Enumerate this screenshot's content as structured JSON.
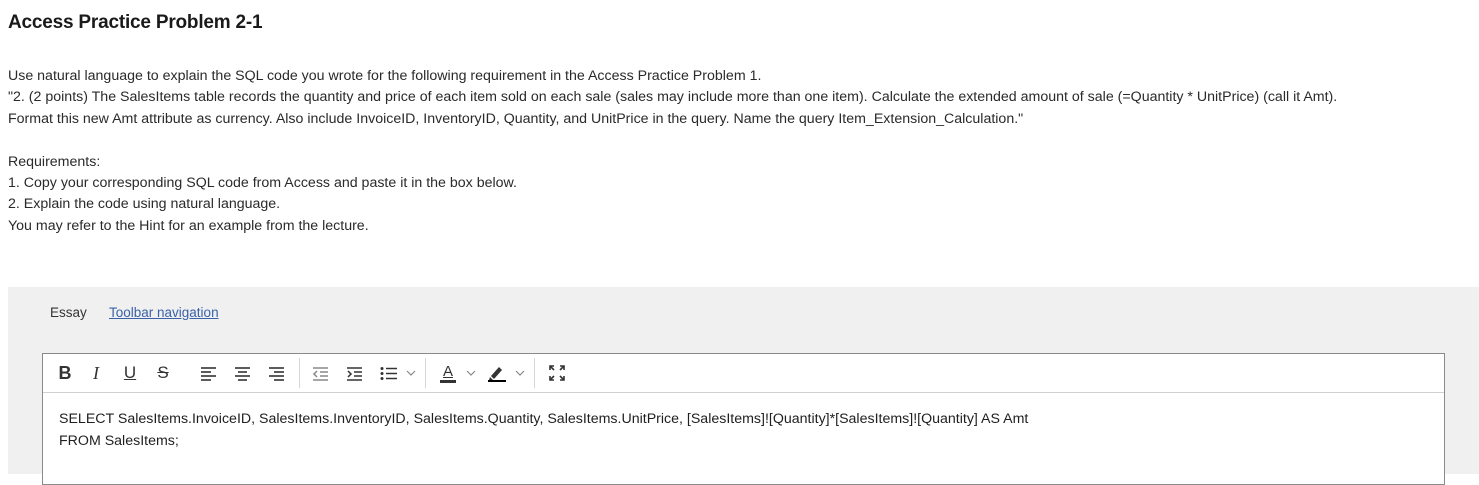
{
  "page": {
    "title": "Access Practice Problem 2-1"
  },
  "instructions": {
    "line1": "Use natural language to explain the SQL code you wrote for the following requirement in the Access Practice Problem 1.",
    "line2": "\"2. (2 points) The SalesItems table records the quantity and price of each item sold on each sale (sales may include more than one item). Calculate the extended amount of sale (=Quantity * UnitPrice) (call it Amt).",
    "line3": "Format this new Amt attribute as currency. Also include InvoiceID, InventoryID, Quantity, and UnitPrice in the query. Name the query Item_Extension_Calculation.\"",
    "requirements_heading": "Requirements:",
    "req1": "1. Copy your corresponding SQL code from Access and paste it in the box below.",
    "req2": "2. Explain the code using natural language.",
    "req3": "You may refer to the Hint for an example from the lecture."
  },
  "essay": {
    "label": "Essay",
    "toolbar_nav_link": "Toolbar navigation",
    "toolbar": {
      "bold": "B",
      "italic": "I",
      "underline": "U",
      "strike": "S",
      "font_color_letter": "A"
    },
    "content": {
      "line1": "SELECT SalesItems.InvoiceID, SalesItems.InventoryID, SalesItems.Quantity, SalesItems.UnitPrice, [SalesItems]![Quantity]*[SalesItems]![Quantity] AS Amt",
      "line2": "FROM SalesItems;"
    }
  },
  "colors": {
    "link": "#3a62a8",
    "band": "#f0f0f0",
    "editor_border": "#8a8a8a",
    "highlight_bar": "#000000"
  }
}
